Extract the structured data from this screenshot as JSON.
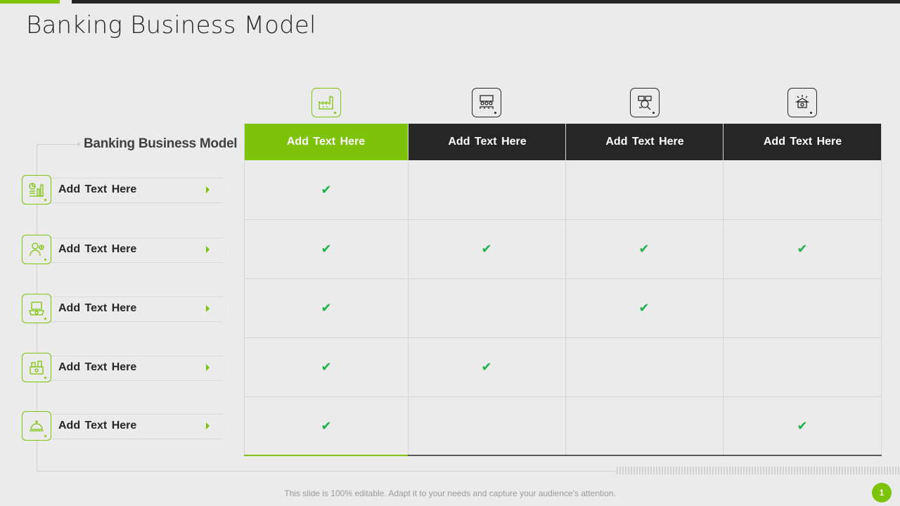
{
  "slide": {
    "title": "Banking Business Model",
    "model_label": "Banking Business Model",
    "footer_note": "This slide is 100% editable. Adapt it to your needs and capture your audience’s attention.",
    "page_number": "1"
  },
  "colors": {
    "accent": "#7dc30a",
    "dark": "#262626",
    "check": "#1db24a",
    "background": "#ebebeb"
  },
  "columns": [
    {
      "label": "Add  Text Here",
      "icon": "factory-icon",
      "highlight": true
    },
    {
      "label": "Add  Text Here",
      "icon": "team-meeting-icon",
      "highlight": false
    },
    {
      "label": "Add  Text Here",
      "icon": "analytics-magnifier-icon",
      "highlight": false
    },
    {
      "label": "Add  Text Here",
      "icon": "bank-idea-icon",
      "highlight": false
    }
  ],
  "rows": [
    {
      "label": "Add  Text Here",
      "icon": "finance-chart-icon",
      "checks": [
        true,
        false,
        false,
        false
      ]
    },
    {
      "label": "Add  Text Here",
      "icon": "banker-person-icon",
      "checks": [
        true,
        true,
        true,
        true
      ]
    },
    {
      "label": "Add  Text Here",
      "icon": "laptop-bag-icon",
      "checks": [
        true,
        false,
        true,
        false
      ]
    },
    {
      "label": "Add  Text Here",
      "icon": "money-wallet-icon",
      "checks": [
        true,
        true,
        false,
        false
      ]
    },
    {
      "label": "Add  Text Here",
      "icon": "service-bell-icon",
      "checks": [
        true,
        false,
        false,
        true
      ]
    }
  ]
}
